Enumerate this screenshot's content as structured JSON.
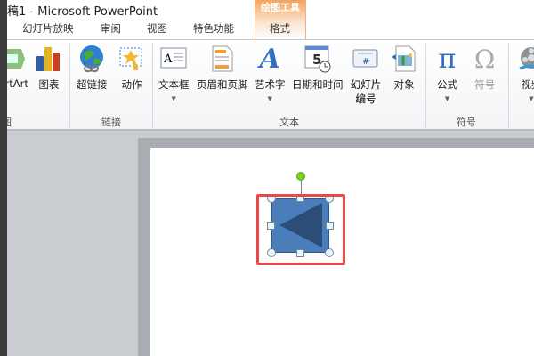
{
  "window": {
    "title": "稿1 - Microsoft PowerPoint",
    "contextual_tab_group": "绘图工具"
  },
  "tabs": [
    "幻灯片放映",
    "审阅",
    "视图",
    "特色功能",
    "格式"
  ],
  "ribbon": {
    "illustrations": {
      "buttons": [
        "SmartArt",
        "图表"
      ],
      "label": "图"
    },
    "links": {
      "buttons": [
        "超链接",
        "动作"
      ],
      "label": "链接"
    },
    "text": {
      "buttons": [
        "文本框",
        "页眉和页脚",
        "艺术字",
        "日期和时间",
        "幻灯片编号",
        "对象"
      ],
      "slide_number_line1": "幻灯片",
      "slide_number_line2": "编号",
      "label": "文本"
    },
    "symbols": {
      "buttons": [
        "公式",
        "符号"
      ],
      "label": "符号"
    },
    "media": {
      "buttons": [
        "视频"
      ]
    }
  },
  "colors": {
    "shape_fill": "#4a7ebb",
    "highlight": "#e84848",
    "contextual": "#f5a35c"
  }
}
